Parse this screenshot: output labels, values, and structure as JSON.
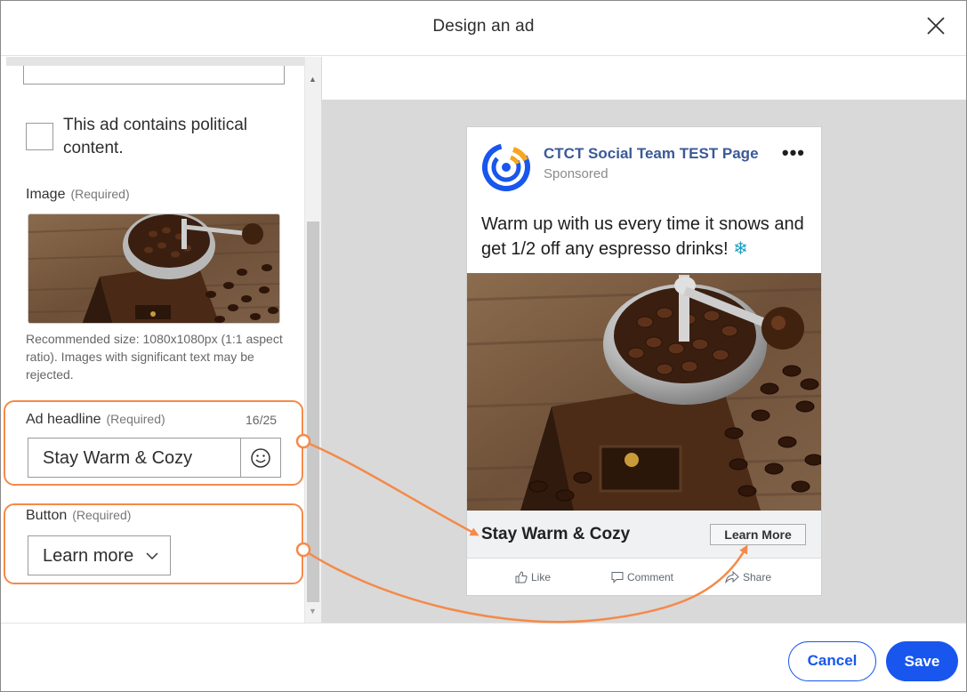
{
  "dialog": {
    "title": "Design an ad"
  },
  "form": {
    "political_label": "This ad contains political content.",
    "image_label": "Image",
    "image_required": "(Required)",
    "image_recommendation": "Recommended size: 1080x1080px (1:1 aspect ratio). Images with significant text may be rejected.",
    "headline_label": "Ad headline",
    "headline_required": "(Required)",
    "headline_count": "16/25",
    "headline_value": "Stay Warm & Cozy",
    "button_label": "Button",
    "button_required": "(Required)",
    "button_value": "Learn more"
  },
  "preview": {
    "page_name": "CTCT Social Team TEST Page",
    "sponsored": "Sponsored",
    "ad_text": "Warm up with us every time it snows and get 1/2 off any espresso drinks!",
    "snowflake": "❄",
    "headline": "Stay Warm & Cozy",
    "cta_button": "Learn More",
    "actions": {
      "like": "Like",
      "comment": "Comment",
      "share": "Share"
    }
  },
  "footer": {
    "cancel": "Cancel",
    "save": "Save"
  },
  "colors": {
    "accent": "#1856ed",
    "highlight": "#f48a4a",
    "page_name": "#3b5998"
  }
}
